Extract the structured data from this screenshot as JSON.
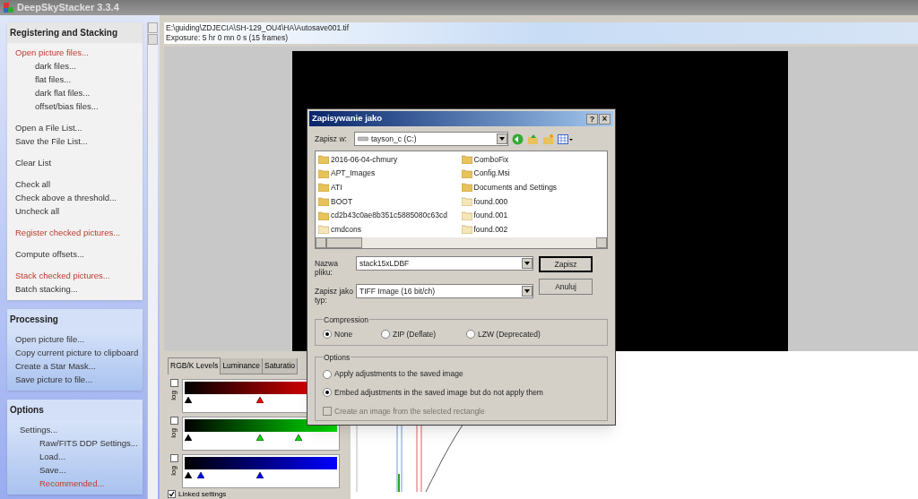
{
  "window": {
    "title": "DeepSkyStacker 3.3.4"
  },
  "sidebar": {
    "sections": [
      {
        "title": "Registering and Stacking",
        "groups": [
          [
            {
              "label": "Open picture files...",
              "highlighted": true,
              "children": [
                {
                  "label": "dark files...",
                  "highlighted": false
                },
                {
                  "label": "flat files...",
                  "highlighted": false
                },
                {
                  "label": "dark flat files...",
                  "highlighted": false
                },
                {
                  "label": "offset/bias files...",
                  "highlighted": false
                }
              ]
            }
          ],
          [
            {
              "label": "Open a File List...",
              "highlighted": false
            },
            {
              "label": "Save the File List...",
              "highlighted": false
            }
          ],
          [
            {
              "label": "Clear List",
              "highlighted": false
            }
          ],
          [
            {
              "label": "Check all",
              "highlighted": false
            },
            {
              "label": "Check above a threshold...",
              "highlighted": false
            },
            {
              "label": "Uncheck all",
              "highlighted": false
            }
          ],
          [
            {
              "label": "Register checked pictures...",
              "highlighted": true
            }
          ],
          [
            {
              "label": "Compute offsets...",
              "highlighted": false
            }
          ],
          [
            {
              "label": "Stack checked pictures...",
              "highlighted": true
            },
            {
              "label": "Batch stacking...",
              "highlighted": false
            }
          ]
        ]
      },
      {
        "title": "Processing",
        "groups": [
          [
            {
              "label": "Open picture file...",
              "highlighted": false
            },
            {
              "label": "Copy current picture to clipboard",
              "highlighted": false
            },
            {
              "label": "Create a Star Mask...",
              "highlighted": false
            },
            {
              "label": "Save picture to file...",
              "highlighted": false
            }
          ]
        ]
      },
      {
        "title": "Options",
        "groups": [
          [
            {
              "label": "Settings...",
              "highlighted": false,
              "children": [
                {
                  "label": "Raw/FITS DDP Settings...",
                  "highlighted": false
                },
                {
                  "label": "Load...",
                  "highlighted": false
                },
                {
                  "label": "Save...",
                  "highlighted": false
                },
                {
                  "label": "Recommended...",
                  "highlighted": true
                }
              ]
            }
          ]
        ]
      }
    ]
  },
  "image_info": {
    "path": "E:\\guiding\\ZDJECIA\\SH-129_OU4\\HA\\Autosave001.tif",
    "exposure": "Exposure: 5 hr 0 mn 0 s (15 frames)"
  },
  "adjust_panel": {
    "tabs": [
      {
        "label": "RGB/K Levels",
        "selected": true
      },
      {
        "label": "Luminance",
        "selected": false
      },
      {
        "label": "Saturatio",
        "selected": false
      }
    ],
    "channels": [
      {
        "log_label": "log",
        "checked": false,
        "color": "#ff0000",
        "markers": [
          {
            "level": 0
          },
          {
            "level": 0.5
          }
        ]
      },
      {
        "log_label": "log",
        "checked": false,
        "color": "#00e000",
        "markers": [
          {
            "level": 0
          },
          {
            "level": 0.5
          },
          {
            "level": 0.77
          }
        ]
      },
      {
        "log_label": "log",
        "checked": false,
        "color": "#0000ff",
        "markers": [
          {
            "level": 0
          },
          {
            "level": 0.09
          },
          {
            "level": 0.5
          }
        ]
      }
    ],
    "linked": {
      "label": "Linked settings",
      "checked": true
    }
  },
  "dialog": {
    "title": "Zapisywanie jako",
    "help": "?",
    "close": "×",
    "save_in": {
      "label": "Zapisz w:",
      "value": "tayson_c (C:)"
    },
    "files": [
      {
        "name": "2016-06-04-chmury",
        "kind": "folder"
      },
      {
        "name": "APT_Images",
        "kind": "folder"
      },
      {
        "name": "ATI",
        "kind": "folder"
      },
      {
        "name": "BOOT",
        "kind": "folder"
      },
      {
        "name": "cd2b43c0ae8b351c5885080c63cd",
        "kind": "folder"
      },
      {
        "name": "cmdcons",
        "kind": "hidden"
      },
      {
        "name": "ComboFix",
        "kind": "folder"
      },
      {
        "name": "Config.Msi",
        "kind": "folder"
      },
      {
        "name": "Documents and Settings",
        "kind": "folder"
      },
      {
        "name": "found.000",
        "kind": "hidden"
      },
      {
        "name": "found.001",
        "kind": "hidden"
      },
      {
        "name": "found.002",
        "kind": "hidden"
      }
    ],
    "file_name": {
      "label": "Nazwa pliku:",
      "value": "stack15xLDBF"
    },
    "file_type": {
      "label": "Zapisz jako typ:",
      "value": "TIFF Image (16 bit/ch)"
    },
    "buttons": [
      {
        "label": "Zapisz",
        "default": true
      },
      {
        "label": "Anuluj",
        "default": false
      }
    ],
    "compression": {
      "title": "Compression",
      "options": [
        {
          "label": "None",
          "selected": true
        },
        {
          "label": "ZIP (Deflate)",
          "selected": false
        },
        {
          "label": "LZW (Deprecated)",
          "selected": false
        }
      ]
    },
    "options": {
      "title": "Options",
      "radios": [
        {
          "label": "Apply adjustments to the saved image",
          "selected": false
        },
        {
          "label": "Embed adjustments in the saved image but do not apply them",
          "selected": true
        }
      ],
      "checkbox": {
        "label": "Create an image from the selected rectangle",
        "checked": false,
        "disabled": true
      }
    }
  }
}
